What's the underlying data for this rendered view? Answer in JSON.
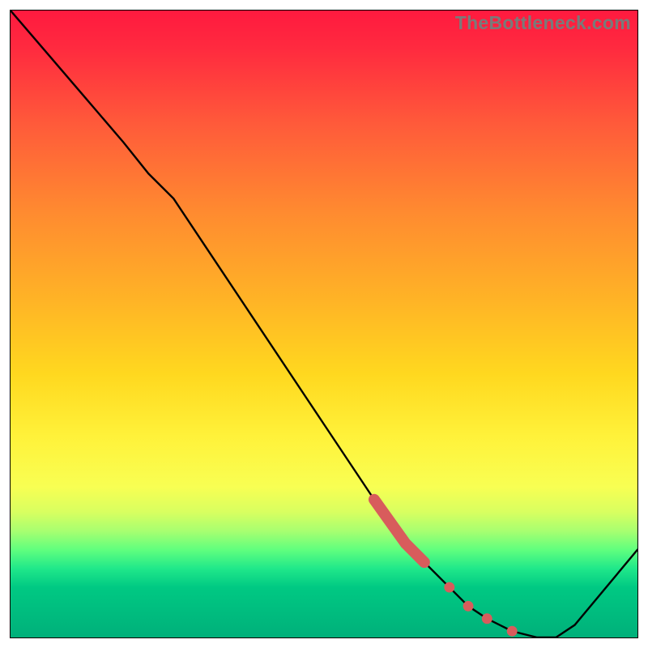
{
  "watermark": {
    "text": "TheBottleneck.com"
  },
  "chart_data": {
    "type": "line",
    "title": "",
    "xlabel": "",
    "ylabel": "",
    "xlim": [
      0,
      100
    ],
    "ylim": [
      0,
      100
    ],
    "grid": false,
    "legend": false,
    "series": [
      {
        "name": "bottleneck-curve",
        "color": "#000000",
        "x": [
          0,
          6,
          12,
          18,
          22,
          26,
          38,
          50,
          58,
          63,
          66,
          70,
          73,
          76,
          80,
          84,
          87,
          90,
          100
        ],
        "y": [
          100,
          93,
          86,
          79,
          74,
          70,
          52,
          34,
          22,
          15,
          12,
          8,
          5,
          3,
          1,
          0,
          0,
          2,
          14
        ]
      }
    ],
    "markers": [
      {
        "name": "highlight-segment",
        "shape": "thick-stroke",
        "color": "#d85c5c",
        "x": [
          58,
          63,
          66
        ],
        "y": [
          22,
          15,
          12
        ]
      },
      {
        "name": "dot-1",
        "shape": "circle",
        "color": "#d85c5c",
        "x": 70,
        "y": 8
      },
      {
        "name": "dot-2",
        "shape": "circle",
        "color": "#d85c5c",
        "x": 73,
        "y": 5
      },
      {
        "name": "dot-3",
        "shape": "circle",
        "color": "#d85c5c",
        "x": 76,
        "y": 3
      },
      {
        "name": "dot-4",
        "shape": "circle",
        "color": "#d85c5c",
        "x": 80,
        "y": 1
      }
    ],
    "background_gradient": {
      "direction": "vertical",
      "stops": [
        {
          "pos": 0.0,
          "color": "#ff1a3f"
        },
        {
          "pos": 0.32,
          "color": "#ff8a30"
        },
        {
          "pos": 0.58,
          "color": "#ffd81f"
        },
        {
          "pos": 0.76,
          "color": "#f8ff53"
        },
        {
          "pos": 0.89,
          "color": "#20e88a"
        },
        {
          "pos": 1.0,
          "color": "#00b07a"
        }
      ]
    }
  }
}
